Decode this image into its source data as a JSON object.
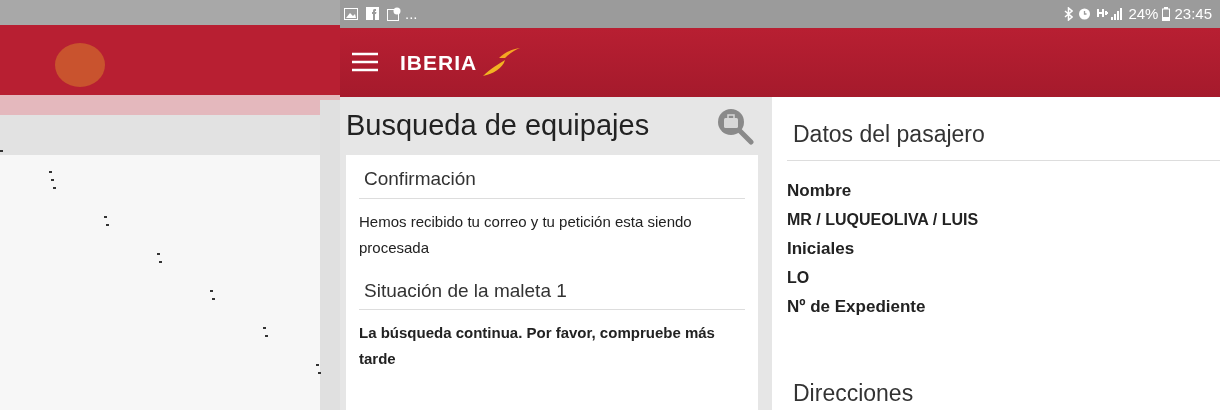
{
  "status_bar": {
    "overflow": "...",
    "battery": "24%",
    "time": "23:45"
  },
  "app_bar": {
    "logo": "IBERIA"
  },
  "search": {
    "title": "Busqueda de equipajes",
    "sections": [
      {
        "heading": "Confirmación",
        "text": "Hemos recibido tu correo y tu petición esta siendo procesada",
        "emphasis": false
      },
      {
        "heading": "Situación de la maleta 1",
        "text": "La búsqueda continua. Por favor, compruebe más tarde",
        "emphasis": true
      }
    ]
  },
  "passenger": {
    "heading": "Datos del pasajero",
    "fields": [
      {
        "label": "Nombre",
        "value": "MR / LUQUEOLIVA / LUIS"
      },
      {
        "label": "Iniciales",
        "value": "LO"
      },
      {
        "label": "Nº de Expediente"
      }
    ],
    "next_heading": "Direcciones"
  }
}
